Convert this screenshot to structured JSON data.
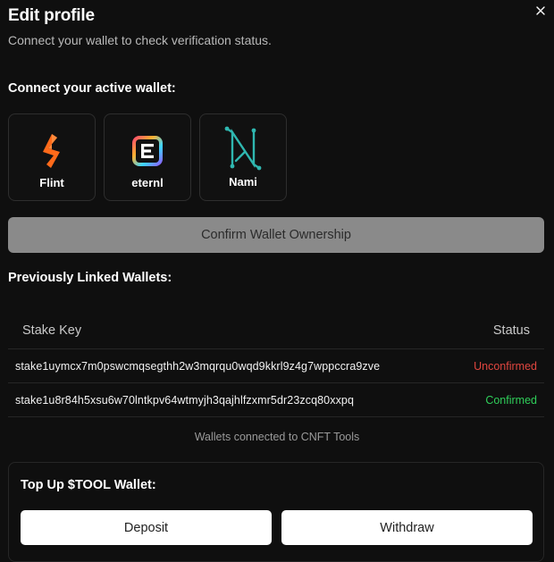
{
  "modal": {
    "title": "Edit profile",
    "subtitle": "Connect your wallet to check verification status.",
    "close_icon": "close-icon"
  },
  "connect": {
    "label": "Connect your active wallet:",
    "wallets": [
      {
        "name": "Flint",
        "icon": "flint-logo-icon"
      },
      {
        "name": "eternl",
        "icon": "eternl-logo-icon"
      },
      {
        "name": "Nami",
        "icon": "nami-logo-icon"
      }
    ],
    "confirm_label": "Confirm Wallet Ownership"
  },
  "linked": {
    "label": "Previously Linked Wallets:",
    "columns": {
      "key": "Stake Key",
      "status": "Status"
    },
    "rows": [
      {
        "key": "stake1uymcx7m0pswcmqsegthh2w3mqrqu0wqd9kkrl9z4g7wppccra9zve",
        "status": "Unconfirmed",
        "status_color": "#e0463f"
      },
      {
        "key": "stake1u8r84h5xsu6w70lntkpv64wtmyjh3qajhlfzxmr5dr23zcq80xxpq",
        "status": "Confirmed",
        "status_color": "#2fcf5a"
      }
    ],
    "caption": "Wallets connected to CNFT Tools"
  },
  "topup": {
    "title": "Top Up $TOOL Wallet:",
    "deposit_label": "Deposit",
    "withdraw_label": "Withdraw"
  },
  "colors": {
    "background": "#0f0f0f",
    "confirm_button": "#8a8a8a",
    "unconfirmed": "#e0463f",
    "confirmed": "#2fcf5a"
  }
}
